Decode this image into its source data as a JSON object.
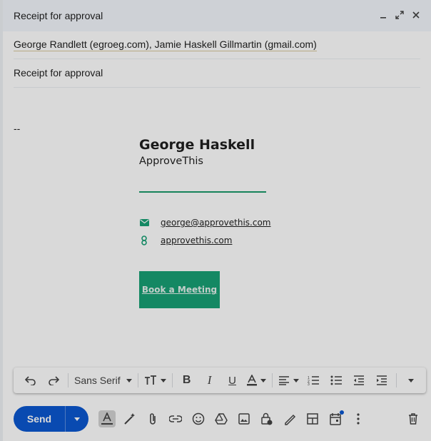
{
  "compose": {
    "title": "Receipt for approval",
    "window_buttons": [
      "minimize-icon",
      "expand-icon",
      "close-icon"
    ],
    "to": "George Randlett (egroeg.com), Jamie Haskell Gillmartin (gmail.com)",
    "subject": "Receipt for approval",
    "body_dashes": "--"
  },
  "signature": {
    "name": "George Haskell",
    "company": "ApproveThis",
    "email": "george@approvethis.com",
    "website": "approvethis.com",
    "meeting_button": "Book a Meeting",
    "accent": "#18a075"
  },
  "formatting": {
    "font": "Sans Serif",
    "tools": [
      "undo-icon",
      "redo-icon",
      "font-size-icon",
      "bold-icon",
      "italic-icon",
      "underline-icon",
      "text-color-icon",
      "align-icon",
      "numbered-list-icon",
      "bulleted-list-icon",
      "indent-less-icon",
      "indent-more-icon",
      "more-formatting-icon"
    ]
  },
  "bottom_bar": {
    "send_label": "Send",
    "send_color": "#0b57d0",
    "tools": [
      "formatting-options-icon",
      "ai-write-icon",
      "attach-icon",
      "link-icon",
      "emoji-icon",
      "drive-icon",
      "photo-icon",
      "confidential-icon",
      "signature-icon",
      "layouts-icon",
      "schedule-icon",
      "more-options-icon",
      "delete-icon"
    ]
  }
}
